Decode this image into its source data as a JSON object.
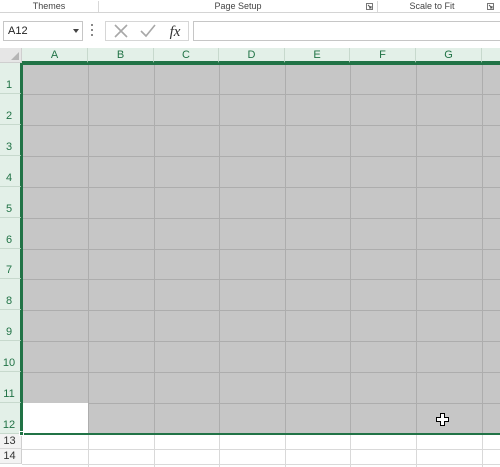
{
  "ribbon": {
    "groups": [
      {
        "label": "Themes",
        "has_launcher": false
      },
      {
        "label": "Page Setup",
        "has_launcher": true
      },
      {
        "label": "Scale to Fit",
        "has_launcher": true
      }
    ]
  },
  "formula_bar": {
    "name_box": "A12",
    "formula": "",
    "cancel_icon": "x-icon",
    "enter_icon": "check-icon",
    "function_label": "fx"
  },
  "sheet": {
    "columns": [
      "A",
      "B",
      "C",
      "D",
      "E",
      "F",
      "G"
    ],
    "rows": [
      "1",
      "2",
      "3",
      "4",
      "5",
      "6",
      "7",
      "8",
      "9",
      "10",
      "11",
      "12"
    ],
    "extra_rows": [
      "13",
      "14"
    ],
    "active_cell": "A12",
    "selected_range": "A1:G12",
    "colors": {
      "accent": "#217346",
      "selection": "#c6c6c6",
      "header_highlight": "#e3f0e8"
    }
  }
}
